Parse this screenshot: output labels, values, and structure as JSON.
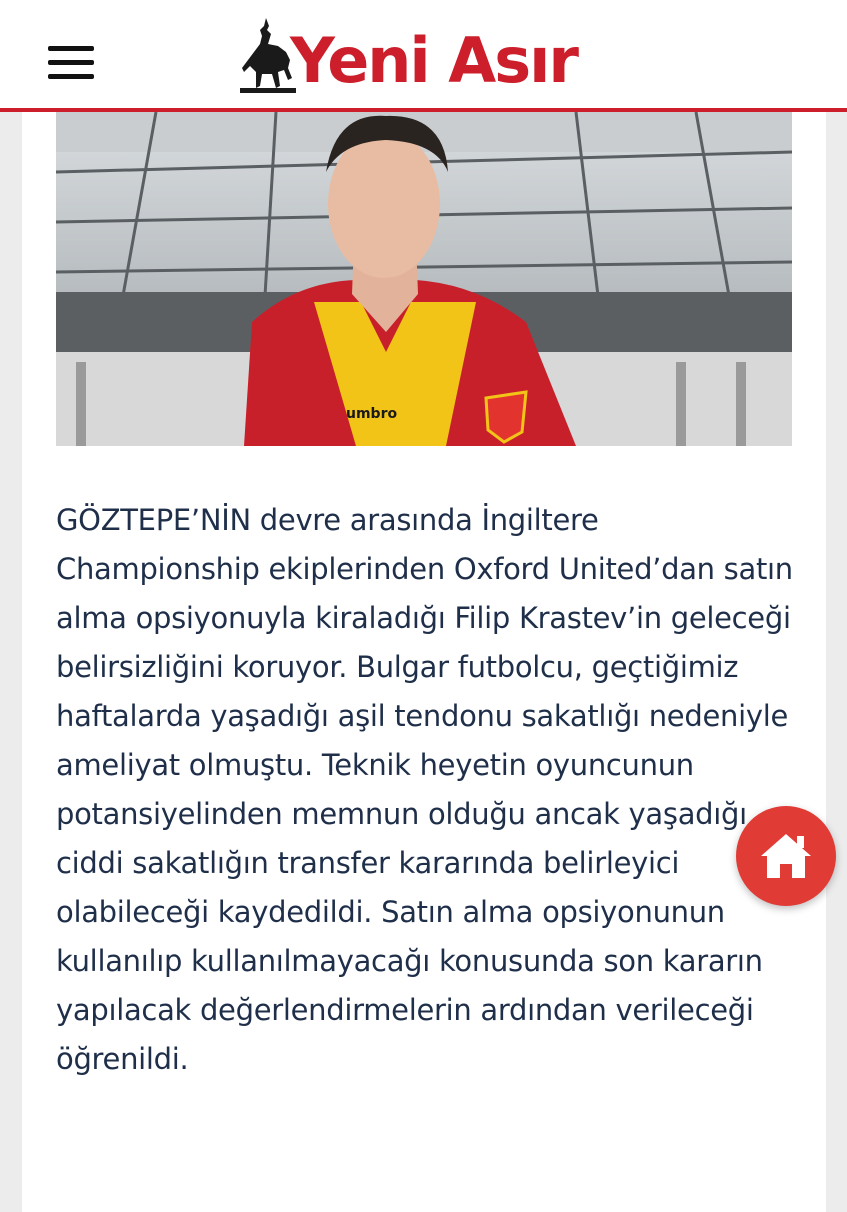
{
  "header": {
    "logo_text": "Yeni Asır",
    "menu_icon": "hamburger-menu-icon",
    "brand_color": "#cc1f2b"
  },
  "article": {
    "hero_image": "player-photo",
    "body": "GÖZTEPE’NİN devre arasında İngiltere Championship ekiplerinden Oxford United’dan satın alma opsiyonuyla kiraladığı Filip Krastev’in geleceği belirsizliğini koruyor. Bulgar futbolcu, geçtiğimiz haftalarda yaşadığı aşil tendonu sakatlığı nedeniyle ameliyat olmuştu. Teknik heyetin oyuncunun potansiyelinden memnun olduğu ancak yaşadığı ciddi sakatlığın transfer kararında belirleyici olabileceği kaydedildi. Satın alma opsiyonunun kullanılıp kullanılmayacağı konusunda son kararın yapılacak değerlendirmelerin ardından verileceği öğrenildi."
  },
  "home_button": {
    "icon": "home-icon",
    "color": "#e03b35"
  }
}
